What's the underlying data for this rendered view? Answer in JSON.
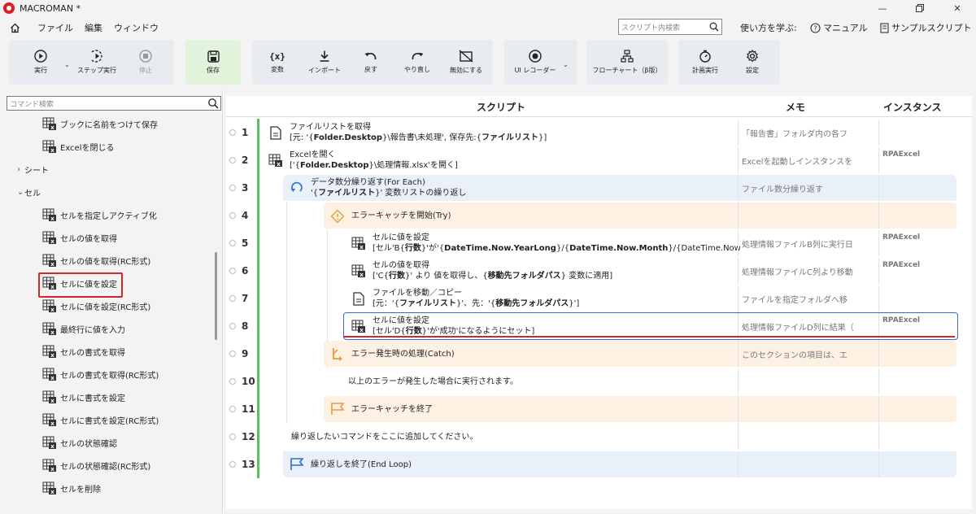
{
  "app": {
    "title": "MACROMAN *"
  },
  "menubar": {
    "items": [
      "ファイル",
      "編集",
      "ウィンドウ"
    ],
    "search_placeholder": "スクリプト内検索",
    "learn": "使い方を学ぶ:",
    "manual": "マニュアル",
    "sample": "サンプルスクリプト"
  },
  "toolbar": {
    "run": "実行",
    "step": "ステップ実行",
    "stop": "停止",
    "save": "保存",
    "variables": "変数",
    "import": "インポート",
    "undo": "戻す",
    "redo": "やり直し",
    "disable": "無効にする",
    "ui_recorder": "UI レコーダー",
    "flowchart": "フローチャート（β版）",
    "schedule": "計画実行",
    "settings": "設定"
  },
  "command_panel": {
    "search_placeholder": "コマンド検索",
    "items": [
      {
        "label": "ブックに名前をつけて保存",
        "type": "cmd"
      },
      {
        "label": "Excelを閉じる",
        "type": "cmd"
      },
      {
        "label": "シート",
        "type": "cat",
        "chevron": ">"
      },
      {
        "label": "セル",
        "type": "cat",
        "chevron": "v"
      },
      {
        "label": "セルを指定しアクティブ化",
        "type": "cmd"
      },
      {
        "label": "セルの値を取得",
        "type": "cmd"
      },
      {
        "label": "セルの値を取得(RC形式)",
        "type": "cmd"
      },
      {
        "label": "セルに値を設定",
        "type": "cmd",
        "selected": true
      },
      {
        "label": "セルに値を設定(RC形式)",
        "type": "cmd"
      },
      {
        "label": "最終行に値を入力",
        "type": "cmd"
      },
      {
        "label": "セルの書式を取得",
        "type": "cmd"
      },
      {
        "label": "セルの書式を取得(RC形式)",
        "type": "cmd"
      },
      {
        "label": "セルに書式を設定",
        "type": "cmd"
      },
      {
        "label": "セルに書式を設定(RC形式)",
        "type": "cmd"
      },
      {
        "label": "セルの状態確認",
        "type": "cmd"
      },
      {
        "label": "セルの状態確認(RC形式)",
        "type": "cmd"
      },
      {
        "label": "セルを削除",
        "type": "cmd"
      }
    ]
  },
  "script": {
    "headers": {
      "script": "スクリプト",
      "memo": "メモ",
      "instance": "インスタンス"
    },
    "rows": [
      {
        "n": "1",
        "icon": "document-icon",
        "line1": "ファイルリストを取得",
        "line2": "[元: '{Folder.Desktop}\\報告書\\未処理', 保存先:{ファイルリスト}]",
        "memo": "「報告書」フォルダ内の各フ",
        "instance": ""
      },
      {
        "n": "2",
        "icon": "excel-icon",
        "line1": "Excelを開く",
        "line2": "['{Folder.Desktop}\\処理情報.xlsx'を開く]",
        "memo": "Excelを起動しインスタンスを",
        "instance": "RPAExcel"
      },
      {
        "n": "3",
        "icon": "loop-icon",
        "line1": "データ数分繰り返す(For Each)",
        "line2": "'{ファイルリスト}' 変数リストの繰り返し",
        "memo": "ファイル数分繰り返す",
        "instance": ""
      },
      {
        "n": "4",
        "icon": "warning-icon",
        "line1": "エラーキャッチを開始(Try)",
        "line2": "",
        "memo": "",
        "instance": ""
      },
      {
        "n": "5",
        "icon": "excel-icon",
        "line1": "セルに値を設定",
        "line2": "[セル'B{行数}'が'{DateTime.Now.YearLong}/{DateTime.Now.Month}/{DateTime.Now",
        "memo": "処理情報ファイルB列に実行日",
        "instance": "RPAExcel"
      },
      {
        "n": "6",
        "icon": "excel-icon",
        "line1": "セルの値を取得",
        "line2": "['C{行数}' より 値を取得し、{移動先フォルダパス} 変数に適用]",
        "memo": "処理情報ファイルC列より移動",
        "instance": "RPAExcel"
      },
      {
        "n": "7",
        "icon": "document-icon",
        "line1": "ファイルを移動／コピー",
        "line2": "[元：'{ファイルリスト}'、先：'{移動先フォルダパス}']",
        "memo": "ファイルを指定フォルダへ移",
        "instance": ""
      },
      {
        "n": "8",
        "icon": "excel-icon",
        "line1": "セルに値を設定",
        "line2": "[セル'D{行数}'が'成功'になるようにセット]",
        "memo": "処理情報ファイルD列に結果（",
        "instance": "RPAExcel"
      },
      {
        "n": "9",
        "icon": "catch-icon",
        "line1": "エラー発生時の処理(Catch)",
        "line2": "",
        "memo": "このセクションの項目は、エ",
        "instance": ""
      },
      {
        "n": "10",
        "icon": "",
        "line1": "以上のエラーが発生した場合に実行されます。",
        "line2": "",
        "memo": "",
        "instance": ""
      },
      {
        "n": "11",
        "icon": "flag-icon",
        "line1": "エラーキャッチを終了",
        "line2": "",
        "memo": "",
        "instance": ""
      },
      {
        "n": "12",
        "icon": "",
        "line1": "繰り返したいコマンドをここに追加してください。",
        "line2": "",
        "memo": "",
        "instance": ""
      },
      {
        "n": "13",
        "icon": "flag-blue-icon",
        "line1": "繰り返しを終了(End Loop)",
        "line2": "",
        "memo": "",
        "instance": ""
      }
    ]
  }
}
